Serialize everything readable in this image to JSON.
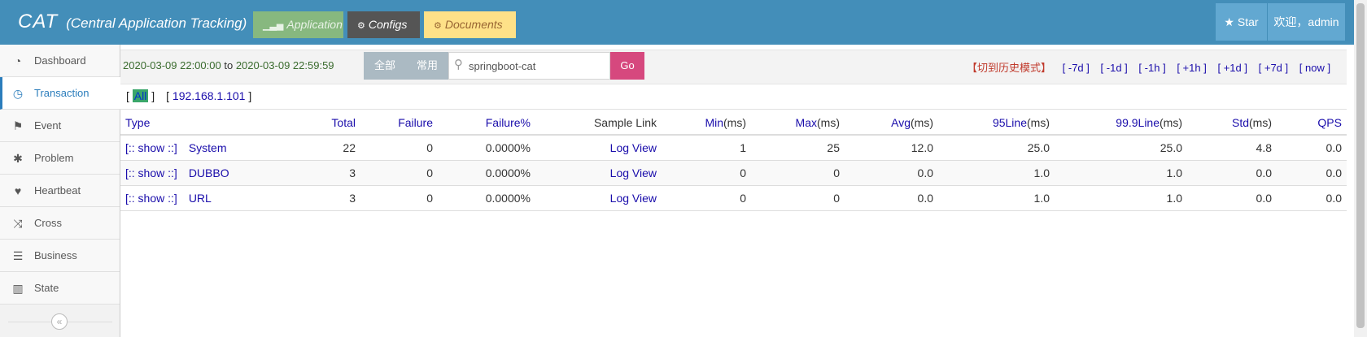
{
  "navbar": {
    "brand": "CAT",
    "subtitle": "(Central Application Tracking)",
    "application": "Application",
    "configs": "Configs",
    "documents": "Documents",
    "star": "Star",
    "user": "欢迎，admin"
  },
  "sidebar": {
    "items": [
      {
        "label": "Dashboard",
        "icon": "tachometer-icon"
      },
      {
        "label": "Transaction",
        "icon": "clock-icon"
      },
      {
        "label": "Event",
        "icon": "flag-icon"
      },
      {
        "label": "Problem",
        "icon": "bug-icon"
      },
      {
        "label": "Heartbeat",
        "icon": "heart-icon"
      },
      {
        "label": "Cross",
        "icon": "random-icon"
      },
      {
        "label": "Business",
        "icon": "list-icon"
      },
      {
        "label": "State",
        "icon": "bar-chart-icon"
      }
    ],
    "active": "Transaction",
    "collapse_glyph": "«"
  },
  "toolbar": {
    "start": "2020-03-09 22:00:00",
    "to": "to",
    "end": "2020-03-09 22:59:59",
    "seg_all": "全部",
    "seg_common": "常用",
    "search_value": "springboot-cat",
    "go": "Go",
    "history_mode": "【切到历史模式】",
    "ranges": [
      "-7d",
      "-1d",
      "-1h",
      "+1h",
      "+1d",
      "+7d",
      "now"
    ]
  },
  "ipfilter": {
    "all": "All",
    "ip": "192.168.1.101"
  },
  "table": {
    "headers": {
      "type": "Type",
      "total": "Total",
      "failure": "Failure",
      "failure_pct": "Failure%",
      "sample": "Sample Link",
      "min": "Min",
      "max": "Max",
      "avg": "Avg",
      "line95": "95Line",
      "line999": "99.9Line",
      "std": "Std",
      "qps": "QPS",
      "ms_unit": "(ms)"
    },
    "show_label": "[:: show ::]",
    "log_view": "Log View",
    "rows": [
      {
        "type": "System",
        "total": "22",
        "failure": "0",
        "failure_pct": "0.0000%",
        "min": "1",
        "max": "25",
        "avg": "12.0",
        "line95": "25.0",
        "line999": "25.0",
        "std": "4.8",
        "qps": "0.0"
      },
      {
        "type": "DUBBO",
        "total": "3",
        "failure": "0",
        "failure_pct": "0.0000%",
        "min": "0",
        "max": "0",
        "avg": "0.0",
        "line95": "1.0",
        "line999": "1.0",
        "std": "0.0",
        "qps": "0.0"
      },
      {
        "type": "URL",
        "total": "3",
        "failure": "0",
        "failure_pct": "0.0000%",
        "min": "0",
        "max": "0",
        "avg": "0.0",
        "line95": "1.0",
        "line999": "1.0",
        "std": "0.0",
        "qps": "0.0"
      }
    ]
  }
}
